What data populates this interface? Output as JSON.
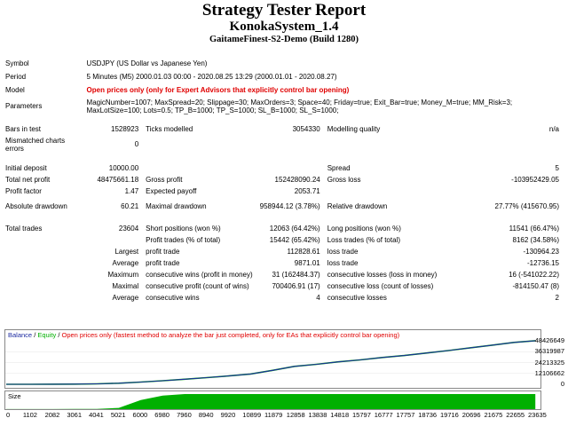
{
  "header": {
    "title": "Strategy Tester Report",
    "expert": "KonokaSystem_1.4",
    "server": "GaitameFinest-S2-Demo (Build 1280)"
  },
  "info": {
    "symbol_label": "Symbol",
    "symbol_value": "USDJPY (US Dollar vs Japanese Yen)",
    "period_label": "Period",
    "period_value": "5 Minutes (M5) 2000.01.03 00:00 - 2020.08.25 13:29 (2000.01.01 - 2020.08.27)",
    "model_label": "Model",
    "model_value": "Open prices only (only for Expert Advisors that explicitly control bar opening)",
    "params_label": "Parameters",
    "params_value": "MagicNumber=1007; MaxSpread=20; Slippage=30; MaxOrders=3; Space=40; Friday=true; Exit_Bar=true; Money_M=true; MM_Risk=3; MaxLotSize=100; Lots=0.5; TP_B=1000; TP_S=1000; SL_B=1000; SL_S=1000;"
  },
  "stats": {
    "bars_label": "Bars in test",
    "bars_value": "1528923",
    "ticks_label": "Ticks modelled",
    "ticks_value": "3054330",
    "quality_label": "Modelling quality",
    "quality_value": "n/a",
    "mismatch_label": "Mismatched charts errors",
    "mismatch_value": "0",
    "deposit_label": "Initial deposit",
    "deposit_value": "10000.00",
    "spread_label": "Spread",
    "spread_value": "5",
    "netprofit_label": "Total net profit",
    "netprofit_value": "48475661.18",
    "grossprofit_label": "Gross profit",
    "grossprofit_value": "152428090.24",
    "grossloss_label": "Gross loss",
    "grossloss_value": "-103952429.05",
    "pf_label": "Profit factor",
    "pf_value": "1.47",
    "payoff_label": "Expected payoff",
    "payoff_value": "2053.71",
    "absdd_label": "Absolute drawdown",
    "absdd_value": "60.21",
    "maxdd_label": "Maximal drawdown",
    "maxdd_value": "958944.12 (3.78%)",
    "reldd_label": "Relative drawdown",
    "reldd_value": "27.77% (415670.95)",
    "trades_label": "Total trades",
    "trades_value": "23604",
    "short_label": "Short positions (won %)",
    "short_value": "12063 (64.42%)",
    "long_label": "Long positions (won %)",
    "long_value": "11541 (66.47%)",
    "ptrades_label": "Profit trades (% of total)",
    "ptrades_value": "15442 (65.42%)",
    "ltrades_label": "Loss trades (% of total)",
    "ltrades_value": "8162 (34.58%)",
    "largest_label": "Largest",
    "lpt_label": "profit trade",
    "lpt_value": "112828.61",
    "llt_label": "loss trade",
    "llt_value": "-130964.23",
    "average_label": "Average",
    "apt_label": "profit trade",
    "apt_value": "9871.01",
    "alt_label": "loss trade",
    "alt_value": "-12736.15",
    "maximum_label": "Maximum",
    "mcw_label": "consecutive wins (profit in money)",
    "mcw_value": "31 (162484.37)",
    "mcl_label": "consecutive losses (loss in money)",
    "mcl_value": "16 (-541022.22)",
    "maximal_label": "Maximal",
    "mcp_label": "consecutive profit (count of wins)",
    "mcp_value": "700406.91 (17)",
    "mcll_label": "consecutive loss (count of losses)",
    "mcll_value": "-814150.47 (8)",
    "average2_label": "Average",
    "acw_label": "consecutive wins",
    "acw_value": "4",
    "acl_label": "consecutive losses",
    "acl_value": "2"
  },
  "chart_legend": {
    "balance": "Balance",
    "sep1": " / ",
    "equity": "Equity",
    "sep2": " / ",
    "note": "Open prices only (fastest method to analyze the bar just completed, only for EAs that explicitly control bar opening)"
  },
  "size_label": "Size",
  "colors": {
    "balance": "#1c2aa0",
    "equity": "#00b000",
    "size": "#00b000",
    "note": "#e00000"
  },
  "chart_data": {
    "type": "line",
    "x": [
      0,
      1102,
      2082,
      3061,
      4041,
      5021,
      6000,
      6980,
      7960,
      8940,
      9920,
      10899,
      11879,
      12858,
      13838,
      14818,
      15797,
      16777,
      17757,
      18736,
      19716,
      20696,
      21675,
      22655,
      23604
    ],
    "series": [
      {
        "name": "Balance",
        "values": [
          10000,
          30000,
          80000,
          200000,
          500000,
          1200000,
          2500000,
          4000000,
          5600000,
          7400000,
          9300000,
          11500000,
          15500000,
          20000000,
          22200000,
          25000000,
          27200000,
          29800000,
          32000000,
          34800000,
          37600000,
          40600000,
          43600000,
          46600000,
          48485661
        ]
      },
      {
        "name": "Size",
        "values": [
          0.5,
          0.5,
          0.6,
          1,
          2,
          8,
          60,
          90,
          100,
          100,
          100,
          100,
          100,
          100,
          100,
          100,
          100,
          100,
          100,
          100,
          100,
          100,
          100,
          100,
          100
        ]
      }
    ],
    "yticks": [
      "48426649",
      "36319987",
      "24213325",
      "12106662",
      "0"
    ],
    "xticks": [
      "0",
      "1102",
      "2082",
      "3061",
      "4041",
      "5021",
      "6000",
      "6980",
      "7960",
      "8940",
      "9920",
      "10899",
      "11879",
      "12858",
      "13838",
      "14818",
      "15797",
      "16777",
      "17757",
      "18736",
      "19716",
      "20696",
      "21675",
      "22655",
      "23635"
    ],
    "ylim": [
      0,
      48426649
    ],
    "xlim": [
      0,
      23635
    ]
  }
}
